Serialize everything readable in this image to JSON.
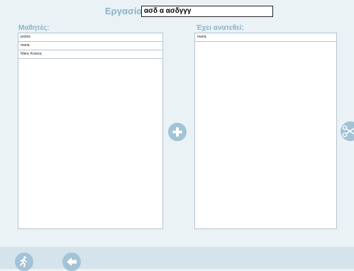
{
  "assignment": {
    "label": "Εργασία:",
    "value": "ασδ α ασδγγγ"
  },
  "students": {
    "heading": "Μαθητές:",
    "items": [
      "protos",
      "maria",
      "Νίκος Κούκος"
    ]
  },
  "assigned": {
    "heading": "Έχει ανατεθεί:",
    "items": [
      "maria"
    ]
  },
  "icons": {
    "add": "plus-circle-icon",
    "remove": "scissors-icon",
    "exit": "running-man-icon",
    "back": "arrow-left-icon"
  },
  "colors": {
    "accent": "#a3c3d6",
    "label": "#8ab3c9",
    "background": "#eaf2f6"
  }
}
